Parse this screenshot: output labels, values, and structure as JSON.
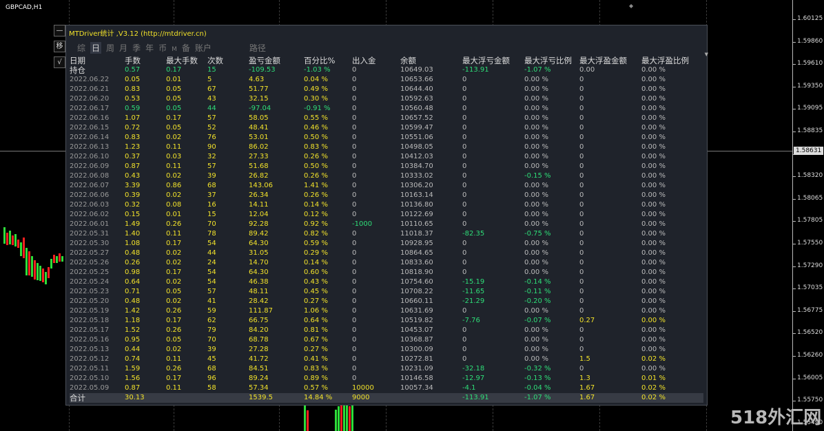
{
  "chart": {
    "symbol": "GBPCAD,H1",
    "bid_marker": "◆",
    "current_price": "1.58631",
    "price_ticks": [
      "1.60125",
      "1.59860",
      "1.59610",
      "1.59350",
      "1.59095",
      "1.58835",
      "1.58585",
      "1.58320",
      "1.58065",
      "1.57805",
      "1.57550",
      "1.57290",
      "1.57035",
      "1.56775",
      "1.56520",
      "1.56260",
      "1.56005",
      "1.55750",
      "1.55490"
    ]
  },
  "side_buttons": {
    "minimize": "—",
    "move": "移",
    "check": "√"
  },
  "panel": {
    "title": "MTDriver统计 ,V3.12 (http://mtdriver.cn)",
    "tabs": [
      {
        "label": "综",
        "active": false
      },
      {
        "label": "日",
        "active": true
      },
      {
        "label": "周",
        "active": false
      },
      {
        "label": "月",
        "active": false
      },
      {
        "label": "季",
        "active": false
      },
      {
        "label": "年",
        "active": false
      },
      {
        "label": "币",
        "active": false
      },
      {
        "label": "M",
        "active": false
      },
      {
        "label": "备",
        "active": false
      },
      {
        "label": "账户",
        "active": false
      },
      {
        "label": "路径",
        "active": false
      }
    ],
    "scroll_arrow": "▼",
    "headers": [
      "日期",
      "手数",
      "最大手数",
      "次数",
      "盈亏金额",
      "百分比%",
      "出入金",
      "余额",
      "最大浮亏金额",
      "最大浮亏比例",
      "最大浮盈金额",
      "最大浮盈比例"
    ],
    "holding": {
      "date": "持仓",
      "lots": "0.57",
      "max_lots": "0.17",
      "count": "15",
      "pl": "-109.53",
      "pct": "-1.03 %",
      "deposit": "0",
      "balance": "10649.03",
      "max_loss": "-113.91",
      "max_loss_pct": "-1.07 %",
      "max_gain": "0.00",
      "max_gain_pct": "0.00 %"
    },
    "rows": [
      {
        "date": "2022.06.22",
        "lots": "0.05",
        "max_lots": "0.01",
        "count": "5",
        "pl": "4.63",
        "pct": "0.04 %",
        "deposit": "0",
        "balance": "10653.66",
        "max_loss": "0",
        "max_loss_pct": "0.00 %",
        "max_gain": "0",
        "max_gain_pct": "0.00 %"
      },
      {
        "date": "2022.06.21",
        "lots": "0.83",
        "max_lots": "0.05",
        "count": "67",
        "pl": "51.77",
        "pct": "0.49 %",
        "deposit": "0",
        "balance": "10644.40",
        "max_loss": "0",
        "max_loss_pct": "0.00 %",
        "max_gain": "0",
        "max_gain_pct": "0.00 %"
      },
      {
        "date": "2022.06.20",
        "lots": "0.53",
        "max_lots": "0.05",
        "count": "43",
        "pl": "32.15",
        "pct": "0.30 %",
        "deposit": "0",
        "balance": "10592.63",
        "max_loss": "0",
        "max_loss_pct": "0.00 %",
        "max_gain": "0",
        "max_gain_pct": "0.00 %"
      },
      {
        "date": "2022.06.17",
        "lots": "0.59",
        "max_lots": "0.05",
        "count": "44",
        "pl": "-97.04",
        "pct": "-0.91 %",
        "deposit": "0",
        "balance": "10560.48",
        "max_loss": "0",
        "max_loss_pct": "0.00 %",
        "max_gain": "0",
        "max_gain_pct": "0.00 %",
        "loss": true
      },
      {
        "date": "2022.06.16",
        "lots": "1.07",
        "max_lots": "0.17",
        "count": "57",
        "pl": "58.05",
        "pct": "0.55 %",
        "deposit": "0",
        "balance": "10657.52",
        "max_loss": "0",
        "max_loss_pct": "0.00 %",
        "max_gain": "0",
        "max_gain_pct": "0.00 %"
      },
      {
        "date": "2022.06.15",
        "lots": "0.72",
        "max_lots": "0.05",
        "count": "52",
        "pl": "48.41",
        "pct": "0.46 %",
        "deposit": "0",
        "balance": "10599.47",
        "max_loss": "0",
        "max_loss_pct": "0.00 %",
        "max_gain": "0",
        "max_gain_pct": "0.00 %"
      },
      {
        "date": "2022.06.14",
        "lots": "0.83",
        "max_lots": "0.02",
        "count": "76",
        "pl": "53.01",
        "pct": "0.50 %",
        "deposit": "0",
        "balance": "10551.06",
        "max_loss": "0",
        "max_loss_pct": "0.00 %",
        "max_gain": "0",
        "max_gain_pct": "0.00 %"
      },
      {
        "date": "2022.06.13",
        "lots": "1.23",
        "max_lots": "0.11",
        "count": "90",
        "pl": "86.02",
        "pct": "0.83 %",
        "deposit": "0",
        "balance": "10498.05",
        "max_loss": "0",
        "max_loss_pct": "0.00 %",
        "max_gain": "0",
        "max_gain_pct": "0.00 %"
      },
      {
        "date": "2022.06.10",
        "lots": "0.37",
        "max_lots": "0.03",
        "count": "32",
        "pl": "27.33",
        "pct": "0.26 %",
        "deposit": "0",
        "balance": "10412.03",
        "max_loss": "0",
        "max_loss_pct": "0.00 %",
        "max_gain": "0",
        "max_gain_pct": "0.00 %"
      },
      {
        "date": "2022.06.09",
        "lots": "0.87",
        "max_lots": "0.11",
        "count": "57",
        "pl": "51.68",
        "pct": "0.50 %",
        "deposit": "0",
        "balance": "10384.70",
        "max_loss": "0",
        "max_loss_pct": "0.00 %",
        "max_gain": "0",
        "max_gain_pct": "0.00 %"
      },
      {
        "date": "2022.06.08",
        "lots": "0.43",
        "max_lots": "0.02",
        "count": "39",
        "pl": "26.82",
        "pct": "0.26 %",
        "deposit": "0",
        "balance": "10333.02",
        "max_loss": "0",
        "max_loss_pct": "-0.15 %",
        "max_gain": "0",
        "max_gain_pct": "0.00 %",
        "mlp_neg": true
      },
      {
        "date": "2022.06.07",
        "lots": "3.39",
        "max_lots": "0.86",
        "count": "68",
        "pl": "143.06",
        "pct": "1.41 %",
        "deposit": "0",
        "balance": "10306.20",
        "max_loss": "0",
        "max_loss_pct": "0.00 %",
        "max_gain": "0",
        "max_gain_pct": "0.00 %"
      },
      {
        "date": "2022.06.06",
        "lots": "0.39",
        "max_lots": "0.02",
        "count": "37",
        "pl": "26.34",
        "pct": "0.26 %",
        "deposit": "0",
        "balance": "10163.14",
        "max_loss": "0",
        "max_loss_pct": "0.00 %",
        "max_gain": "0",
        "max_gain_pct": "0.00 %"
      },
      {
        "date": "2022.06.03",
        "lots": "0.32",
        "max_lots": "0.08",
        "count": "16",
        "pl": "14.11",
        "pct": "0.14 %",
        "deposit": "0",
        "balance": "10136.80",
        "max_loss": "0",
        "max_loss_pct": "0.00 %",
        "max_gain": "0",
        "max_gain_pct": "0.00 %"
      },
      {
        "date": "2022.06.02",
        "lots": "0.15",
        "max_lots": "0.01",
        "count": "15",
        "pl": "12.04",
        "pct": "0.12 %",
        "deposit": "0",
        "balance": "10122.69",
        "max_loss": "0",
        "max_loss_pct": "0.00 %",
        "max_gain": "0",
        "max_gain_pct": "0.00 %"
      },
      {
        "date": "2022.06.01",
        "lots": "1.49",
        "max_lots": "0.26",
        "count": "70",
        "pl": "92.28",
        "pct": "0.92 %",
        "deposit": "-1000",
        "balance": "10110.65",
        "max_loss": "0",
        "max_loss_pct": "0.00 %",
        "max_gain": "0",
        "max_gain_pct": "0.00 %",
        "dep_neg": true
      },
      {
        "date": "2022.05.31",
        "lots": "1.40",
        "max_lots": "0.11",
        "count": "78",
        "pl": "89.42",
        "pct": "0.82 %",
        "deposit": "0",
        "balance": "11018.37",
        "max_loss": "-82.35",
        "max_loss_pct": "-0.75 %",
        "max_gain": "0",
        "max_gain_pct": "0.00 %",
        "ml_neg": true,
        "mlp_neg": true
      },
      {
        "date": "2022.05.30",
        "lots": "1.08",
        "max_lots": "0.17",
        "count": "54",
        "pl": "64.30",
        "pct": "0.59 %",
        "deposit": "0",
        "balance": "10928.95",
        "max_loss": "0",
        "max_loss_pct": "0.00 %",
        "max_gain": "0",
        "max_gain_pct": "0.00 %"
      },
      {
        "date": "2022.05.27",
        "lots": "0.48",
        "max_lots": "0.02",
        "count": "44",
        "pl": "31.05",
        "pct": "0.29 %",
        "deposit": "0",
        "balance": "10864.65",
        "max_loss": "0",
        "max_loss_pct": "0.00 %",
        "max_gain": "0",
        "max_gain_pct": "0.00 %"
      },
      {
        "date": "2022.05.26",
        "lots": "0.26",
        "max_lots": "0.02",
        "count": "24",
        "pl": "14.70",
        "pct": "0.14 %",
        "deposit": "0",
        "balance": "10833.60",
        "max_loss": "0",
        "max_loss_pct": "0.00 %",
        "max_gain": "0",
        "max_gain_pct": "0.00 %"
      },
      {
        "date": "2022.05.25",
        "lots": "0.98",
        "max_lots": "0.17",
        "count": "54",
        "pl": "64.30",
        "pct": "0.60 %",
        "deposit": "0",
        "balance": "10818.90",
        "max_loss": "0",
        "max_loss_pct": "0.00 %",
        "max_gain": "0",
        "max_gain_pct": "0.00 %"
      },
      {
        "date": "2022.05.24",
        "lots": "0.64",
        "max_lots": "0.02",
        "count": "54",
        "pl": "46.38",
        "pct": "0.43 %",
        "deposit": "0",
        "balance": "10754.60",
        "max_loss": "-15.19",
        "max_loss_pct": "-0.14 %",
        "max_gain": "0",
        "max_gain_pct": "0.00 %",
        "ml_neg": true,
        "mlp_neg": true
      },
      {
        "date": "2022.05.23",
        "lots": "0.71",
        "max_lots": "0.05",
        "count": "57",
        "pl": "48.11",
        "pct": "0.45 %",
        "deposit": "0",
        "balance": "10708.22",
        "max_loss": "-11.65",
        "max_loss_pct": "-0.11 %",
        "max_gain": "0",
        "max_gain_pct": "0.00 %",
        "ml_neg": true,
        "mlp_neg": true
      },
      {
        "date": "2022.05.20",
        "lots": "0.48",
        "max_lots": "0.02",
        "count": "41",
        "pl": "28.42",
        "pct": "0.27 %",
        "deposit": "0",
        "balance": "10660.11",
        "max_loss": "-21.29",
        "max_loss_pct": "-0.20 %",
        "max_gain": "0",
        "max_gain_pct": "0.00 %",
        "ml_neg": true,
        "mlp_neg": true
      },
      {
        "date": "2022.05.19",
        "lots": "1.42",
        "max_lots": "0.26",
        "count": "59",
        "pl": "111.87",
        "pct": "1.06 %",
        "deposit": "0",
        "balance": "10631.69",
        "max_loss": "0",
        "max_loss_pct": "0.00 %",
        "max_gain": "0",
        "max_gain_pct": "0.00 %"
      },
      {
        "date": "2022.05.18",
        "lots": "1.18",
        "max_lots": "0.17",
        "count": "62",
        "pl": "66.75",
        "pct": "0.64 %",
        "deposit": "0",
        "balance": "10519.82",
        "max_loss": "-7.76",
        "max_loss_pct": "-0.07 %",
        "max_gain": "0.27",
        "max_gain_pct": "0.00 %",
        "ml_neg": true,
        "mlp_neg": true,
        "mg_pos": true
      },
      {
        "date": "2022.05.17",
        "lots": "1.52",
        "max_lots": "0.26",
        "count": "79",
        "pl": "84.20",
        "pct": "0.81 %",
        "deposit": "0",
        "balance": "10453.07",
        "max_loss": "0",
        "max_loss_pct": "0.00 %",
        "max_gain": "0",
        "max_gain_pct": "0.00 %"
      },
      {
        "date": "2022.05.16",
        "lots": "0.95",
        "max_lots": "0.05",
        "count": "70",
        "pl": "68.78",
        "pct": "0.67 %",
        "deposit": "0",
        "balance": "10368.87",
        "max_loss": "0",
        "max_loss_pct": "0.00 %",
        "max_gain": "0",
        "max_gain_pct": "0.00 %"
      },
      {
        "date": "2022.05.13",
        "lots": "0.44",
        "max_lots": "0.02",
        "count": "39",
        "pl": "27.28",
        "pct": "0.27 %",
        "deposit": "0",
        "balance": "10300.09",
        "max_loss": "0",
        "max_loss_pct": "0.00 %",
        "max_gain": "0",
        "max_gain_pct": "0.00 %"
      },
      {
        "date": "2022.05.12",
        "lots": "0.74",
        "max_lots": "0.11",
        "count": "45",
        "pl": "41.72",
        "pct": "0.41 %",
        "deposit": "0",
        "balance": "10272.81",
        "max_loss": "0",
        "max_loss_pct": "0.00 %",
        "max_gain": "1.5",
        "max_gain_pct": "0.02 %",
        "mg_pos": true
      },
      {
        "date": "2022.05.11",
        "lots": "1.59",
        "max_lots": "0.26",
        "count": "68",
        "pl": "84.51",
        "pct": "0.83 %",
        "deposit": "0",
        "balance": "10231.09",
        "max_loss": "-32.18",
        "max_loss_pct": "-0.32 %",
        "max_gain": "0",
        "max_gain_pct": "0.00 %",
        "ml_neg": true,
        "mlp_neg": true
      },
      {
        "date": "2022.05.10",
        "lots": "1.56",
        "max_lots": "0.17",
        "count": "96",
        "pl": "89.24",
        "pct": "0.89 %",
        "deposit": "0",
        "balance": "10146.58",
        "max_loss": "-12.97",
        "max_loss_pct": "-0.13 %",
        "max_gain": "1.3",
        "max_gain_pct": "0.01 %",
        "ml_neg": true,
        "mlp_neg": true,
        "mg_pos": true
      },
      {
        "date": "2022.05.09",
        "lots": "0.87",
        "max_lots": "0.11",
        "count": "58",
        "pl": "57.34",
        "pct": "0.57 %",
        "deposit": "10000",
        "balance": "10057.34",
        "max_loss": "-4.1",
        "max_loss_pct": "-0.04 %",
        "max_gain": "1.67",
        "max_gain_pct": "0.02 %",
        "dep_pos": true,
        "ml_neg": true,
        "mlp_neg": true,
        "mg_pos": true
      }
    ],
    "total": {
      "date": "合计",
      "lots": "30.13",
      "max_lots": "",
      "count": "",
      "pl": "1539.5",
      "pct": "14.84 %",
      "deposit": "9000",
      "balance": "",
      "max_loss": "-113.91",
      "max_loss_pct": "-1.07 %",
      "max_gain": "1.67",
      "max_gain_pct": "0.02 %"
    }
  },
  "watermark": "518外汇网",
  "colors": {
    "yellow": "#f2e22a",
    "green": "#2ede78",
    "up_candle": "#2ede3a",
    "down_candle": "#ff2020",
    "panel_bg": "#1f232b"
  }
}
